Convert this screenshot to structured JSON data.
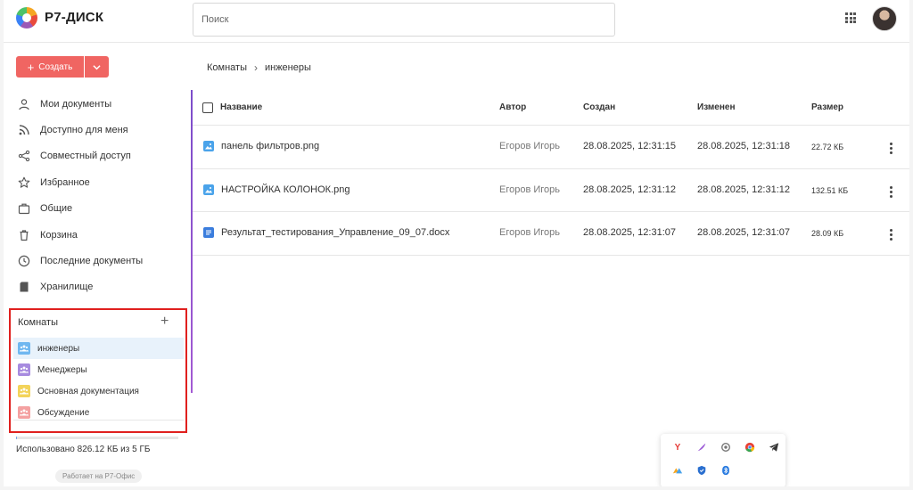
{
  "app": {
    "brand": "Р7-ДИСК"
  },
  "search": {
    "placeholder": "Поиск"
  },
  "sidebar": {
    "create_label": "Создать",
    "items": [
      {
        "label": "Мои документы",
        "icon": "user-icon"
      },
      {
        "label": "Доступно для меня",
        "icon": "rss-icon"
      },
      {
        "label": "Совместный доступ",
        "icon": "share-icon"
      },
      {
        "label": "Избранное",
        "icon": "star-icon"
      },
      {
        "label": "Общие",
        "icon": "briefcase-icon"
      },
      {
        "label": "Корзина",
        "icon": "trash-icon"
      },
      {
        "label": "Последние документы",
        "icon": "clock-icon"
      },
      {
        "label": "Хранилище",
        "icon": "storage-icon"
      }
    ],
    "rooms": {
      "title": "Комнаты",
      "items": [
        {
          "label": "инженеры",
          "color": "#6fb7f0",
          "active": true
        },
        {
          "label": "Менеджеры",
          "color": "#a78bdf",
          "active": false
        },
        {
          "label": "Основная документация",
          "color": "#f3d45b",
          "active": false
        },
        {
          "label": "Обсуждение",
          "color": "#f4a1a1",
          "active": false
        }
      ]
    },
    "quota": {
      "text": "Использовано 826.12 КБ из 5 ГБ",
      "fraction": 0.0002
    },
    "powered_by": "Работает на Р7-Офис"
  },
  "breadcrumb": {
    "root": "Комнаты",
    "current": "инженеры"
  },
  "table": {
    "columns": {
      "name": "Название",
      "author": "Автор",
      "created": "Создан",
      "modified": "Изменен",
      "size": "Размер"
    },
    "rows": [
      {
        "name": "панель фильтров.png",
        "type": "image",
        "author": "Егоров Игорь",
        "created": "28.08.2025, 12:31:15",
        "modified": "28.08.2025, 12:31:18",
        "size": "22.72 КБ"
      },
      {
        "name": "НАСТРОЙКА КОЛОНОК.png",
        "type": "image",
        "author": "Егоров Игорь",
        "created": "28.08.2025, 12:31:12",
        "modified": "28.08.2025, 12:31:12",
        "size": "132.51 КБ"
      },
      {
        "name": "Результат_тестирования_Управление_09_07.docx",
        "type": "document",
        "author": "Егоров Игорь",
        "created": "28.08.2025, 12:31:07",
        "modified": "28.08.2025, 12:31:07",
        "size": "28.09 КБ"
      }
    ]
  },
  "colors": {
    "accent": "#f06562",
    "rooms_highlight": "#e0201e",
    "image_icon": "#4aa3ea",
    "doc_icon": "#3b7ddd"
  }
}
